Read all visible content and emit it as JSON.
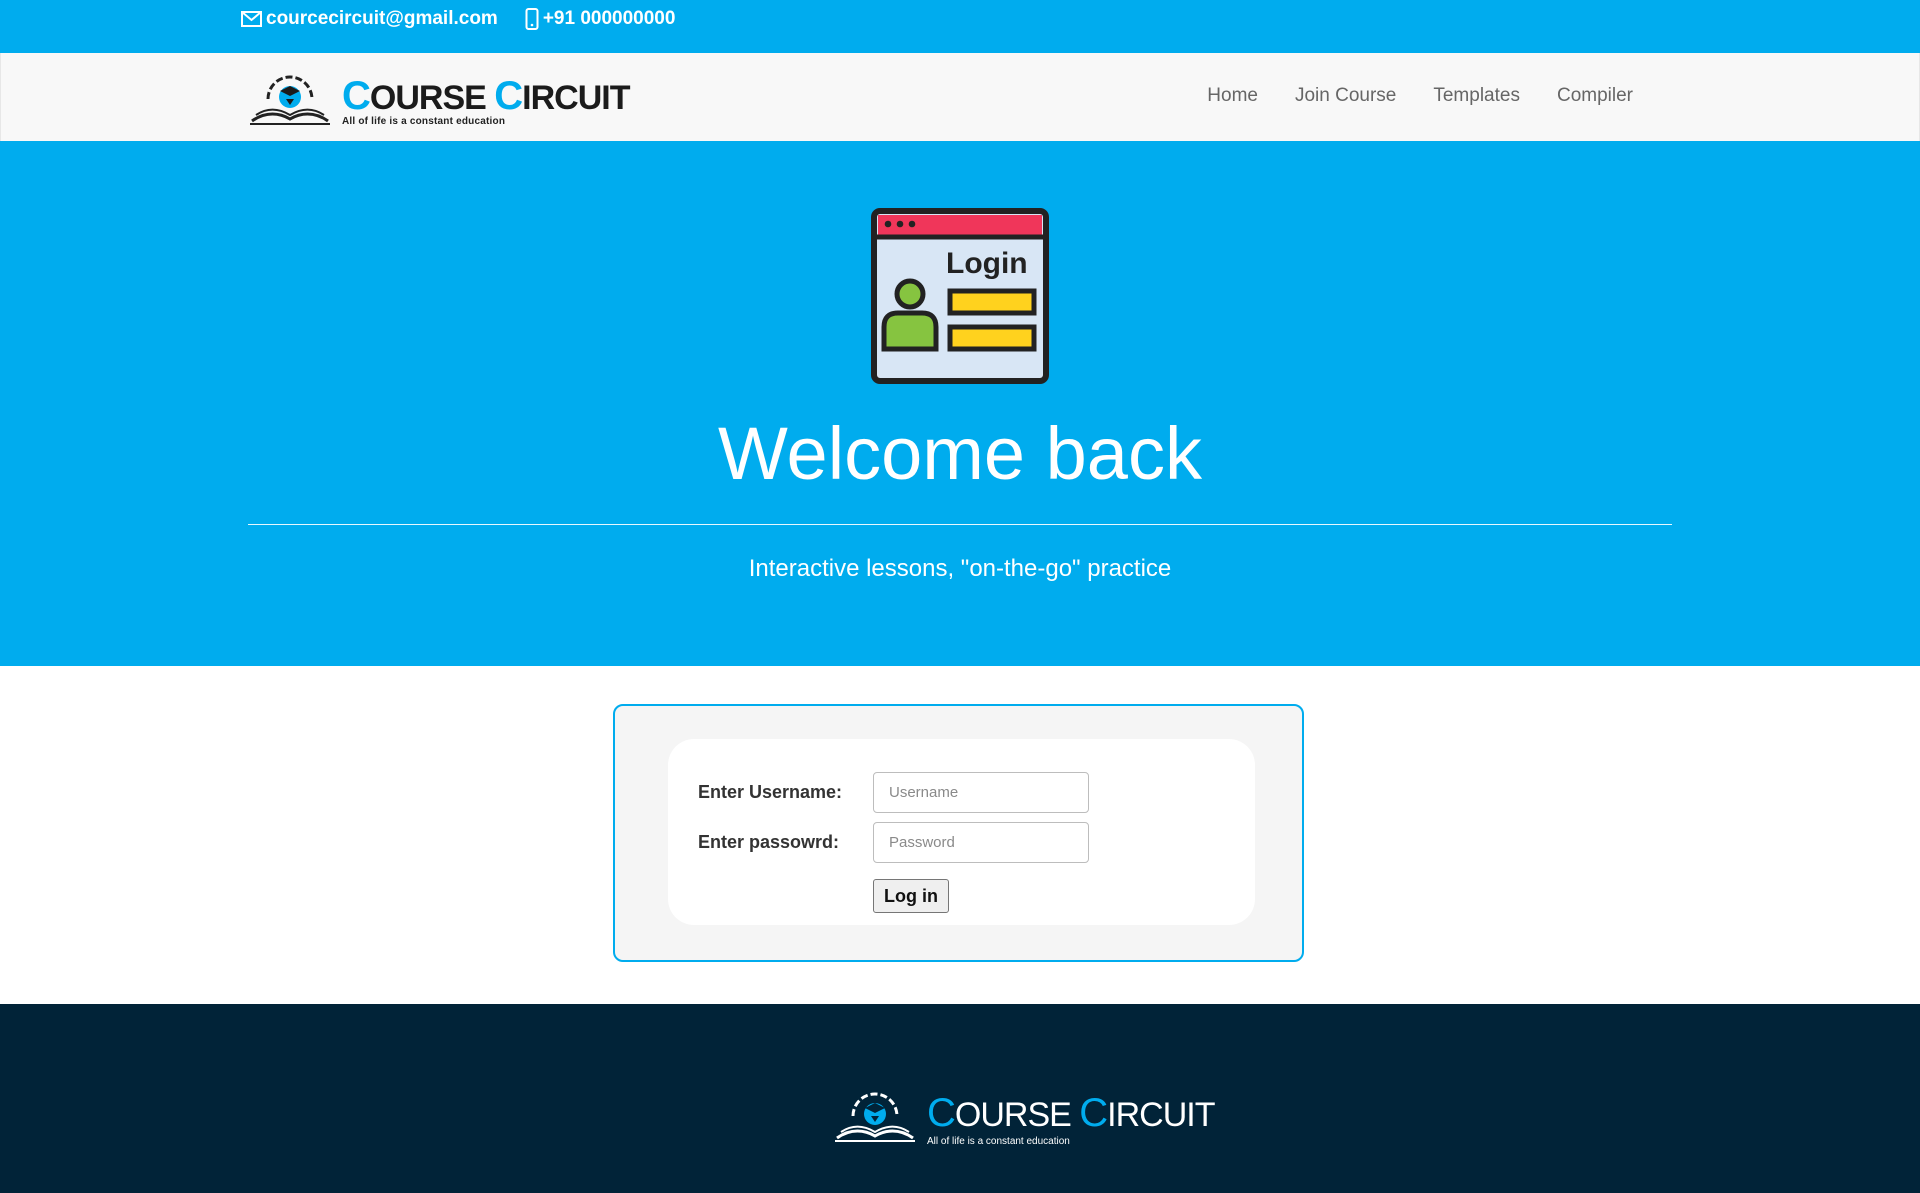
{
  "topbar": {
    "email": "courcecircuit@gmail.com",
    "phone": "+91 000000000",
    "email_icon": "envelope-icon",
    "phone_icon": "mobile-phone-icon"
  },
  "brand": {
    "title_first_cap": "C",
    "title_first_rest": "OURSE ",
    "title_second_cap": "C",
    "title_second_rest": "IRCUIT",
    "tagline": "All of life is a constant education"
  },
  "nav": {
    "items": [
      "Home",
      "Join Course",
      "Templates",
      "Compiler"
    ]
  },
  "hero": {
    "illustration_text": "Login",
    "heading": "Welcome back",
    "subtitle": "Interactive lessons, \"on-the-go\" practice"
  },
  "login_form": {
    "username_label": "Enter Username:",
    "username_placeholder": "Username",
    "password_label": "Enter passowrd:",
    "password_placeholder": "Password",
    "submit_label": "Log in"
  },
  "colors": {
    "accent": "#00acee",
    "footer_bg": "#012338",
    "navbar_bg": "#f8f8f8"
  }
}
